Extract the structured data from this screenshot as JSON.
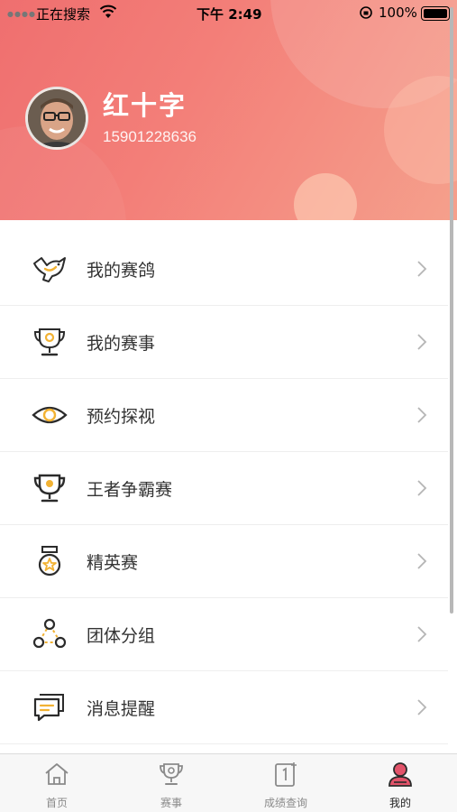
{
  "status_bar": {
    "carrier": "正在搜索",
    "time": "下午 2:49",
    "battery": "100%"
  },
  "profile": {
    "name": "红十字",
    "phone": "15901228636"
  },
  "menu": [
    {
      "label": "我的赛鸽",
      "icon": "pigeon-icon"
    },
    {
      "label": "我的赛事",
      "icon": "trophy-icon"
    },
    {
      "label": "预约探视",
      "icon": "eye-icon"
    },
    {
      "label": "王者争霸赛",
      "icon": "trophy-star-icon"
    },
    {
      "label": "精英赛",
      "icon": "medal-icon"
    },
    {
      "label": "团体分组",
      "icon": "group-icon"
    },
    {
      "label": "消息提醒",
      "icon": "message-icon"
    }
  ],
  "tabbar": [
    {
      "label": "首页",
      "icon": "home-icon"
    },
    {
      "label": "赛事",
      "icon": "trophy-icon"
    },
    {
      "label": "成绩查询",
      "icon": "rank-icon"
    },
    {
      "label": "我的",
      "icon": "user-icon",
      "active": true
    }
  ],
  "colors": {
    "header_start": "#ef6f6f",
    "header_end": "#f5a08c",
    "icon_accent": "#f2b233",
    "icon_stroke": "#2b2b2b"
  }
}
